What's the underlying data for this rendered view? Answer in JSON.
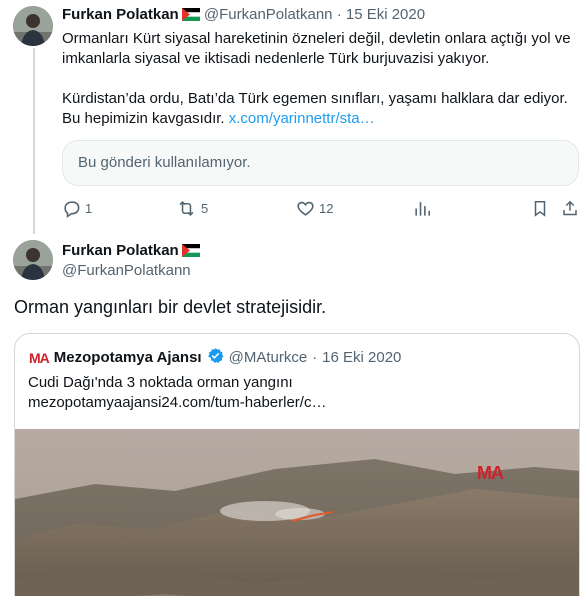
{
  "tweet1": {
    "author_name": "Furkan Polatkan",
    "author_handle": "@FurkanPolatkann",
    "separator": "·",
    "date": "15 Eki 2020",
    "paragraph1": "Ormanları Kürt siyasal hareketinin özneleri değil, devletin onlara açtığı yol ve imkanlarla siyasal ve iktisadi nedenlerle Türk burjuvazisi yakıyor.",
    "paragraph2": "Kürdistan’da ordu, Batı’da Türk egemen sınıfları, yaşamı halklara dar ediyor. Bu hepimizin kavgasıdır.",
    "link": "x.com/yarinnettr/sta…",
    "unavailable_text": "Bu gönderi kullanılamıyor.",
    "replies": "1",
    "retweets": "5",
    "likes": "12"
  },
  "tweet2": {
    "author_name": "Furkan Polatkan",
    "author_handle": "@FurkanPolatkann",
    "text": "Orman yangınları bir devlet stratejisidir.",
    "quote": {
      "logo": "MA",
      "author_name": "Mezopotamya Ajansı",
      "author_handle": "@MAturkce",
      "separator": "·",
      "date": "16 Eki 2020",
      "title": "Cudi Dağı'nda 3 noktada orman yangını",
      "url": "mezopotamyaajansi24.com/tum-haberler/c…",
      "image_watermark": "MA"
    }
  },
  "colors": {
    "link": "#1d9bf0",
    "secondary_text": "#536471",
    "verified": "#1d9bf0",
    "brand_red": "#d0202a"
  },
  "icons": [
    "reply-icon",
    "retweet-icon",
    "like-icon",
    "views-icon",
    "bookmark-icon",
    "share-icon",
    "verified-icon",
    "palestine-flag-icon"
  ]
}
